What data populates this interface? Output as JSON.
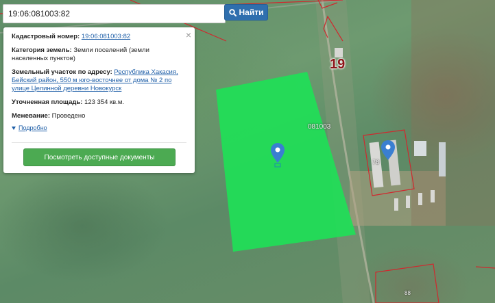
{
  "search": {
    "query": "19:06:081003:82",
    "button_label": "Найти"
  },
  "popup": {
    "cadastral_label": "Кадастровый номер:",
    "cadastral_value": "19:06:081003:82",
    "category_label": "Категория земель:",
    "category_value": "Земли поселений (земли населенных пунктов)",
    "address_label": "Земельный участок по адресу:",
    "address_value": "Республика Хакасия, Бейский район, 550 м юго-восточнее от дома № 2 по улице Целинной деревни Новокурск",
    "area_label": "Уточненная площадь:",
    "area_value": "123 354 кв.м.",
    "survey_label": "Межевание:",
    "survey_value": "Проведено",
    "more_label": "Подробно",
    "docs_button_label": "Посмотреть доступные документы",
    "close_symbol": "×"
  },
  "map": {
    "quarter_number": "19",
    "cadastral_quarter_label": "081003",
    "plot_numbers": [
      "78",
      "88"
    ],
    "colors": {
      "selected_parcel": "#1fe057",
      "boundary": "#d0282e",
      "marker": "#3a7fd1"
    },
    "icons": [
      "location-pin-icon",
      "location-pin-icon"
    ]
  }
}
